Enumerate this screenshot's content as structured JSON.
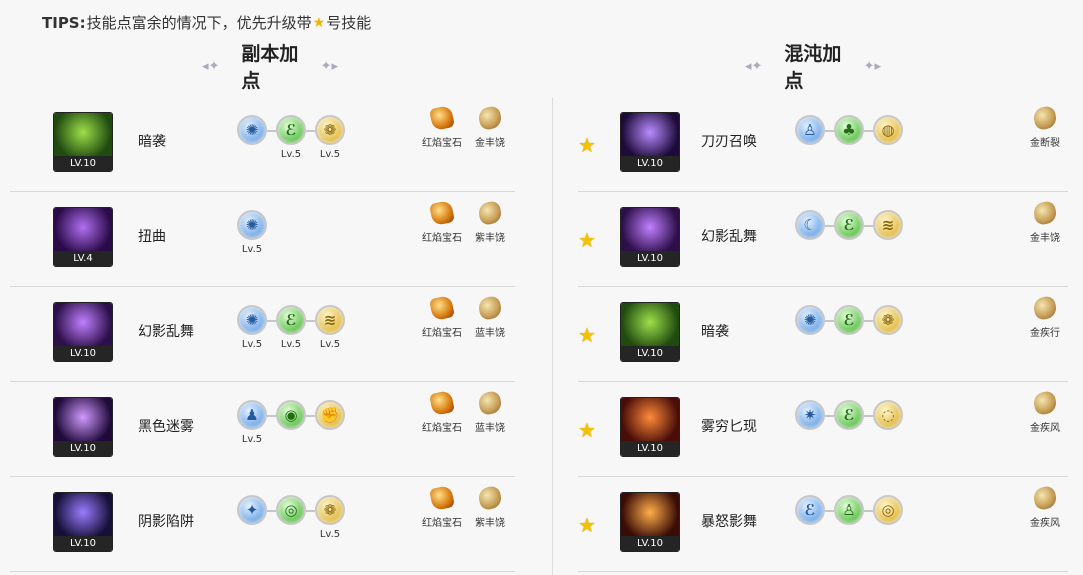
{
  "tips": {
    "prefix": "TIPS:",
    "text_before": "技能点富余的情况下，优先升级带",
    "star": "★",
    "text_after": "号技能"
  },
  "sections": {
    "left_title": "副本加点",
    "right_title": "混沌加点"
  },
  "left_rows": [
    {
      "name": "暗袭",
      "level": "LV.10",
      "runes": [
        {
          "color": "blue",
          "glyph": "✺",
          "lv": ""
        },
        {
          "color": "green",
          "glyph": "ℰ",
          "lv": "Lv.5"
        },
        {
          "color": "gold",
          "glyph": "❁",
          "lv": "Lv.5"
        }
      ],
      "gems": [
        {
          "type": "red",
          "label": "红焰宝石"
        },
        {
          "type": "gold",
          "label": "金丰饶"
        }
      ]
    },
    {
      "name": "扭曲",
      "level": "LV.4",
      "runes": [
        {
          "color": "blue",
          "glyph": "✺",
          "lv": "Lv.5"
        }
      ],
      "gems": [
        {
          "type": "red",
          "label": "红焰宝石"
        },
        {
          "type": "gold",
          "label": "紫丰饶"
        }
      ]
    },
    {
      "name": "幻影乱舞",
      "level": "LV.10",
      "runes": [
        {
          "color": "blue",
          "glyph": "✺",
          "lv": "Lv.5"
        },
        {
          "color": "green",
          "glyph": "ℰ",
          "lv": "Lv.5"
        },
        {
          "color": "gold",
          "glyph": "≋",
          "lv": "Lv.5"
        }
      ],
      "gems": [
        {
          "type": "red",
          "label": "红焰宝石"
        },
        {
          "type": "gold",
          "label": "蓝丰饶"
        }
      ]
    },
    {
      "name": "黑色迷雾",
      "level": "LV.10",
      "runes": [
        {
          "color": "blue",
          "glyph": "♟",
          "lv": "Lv.5"
        },
        {
          "color": "green",
          "glyph": "◉",
          "lv": ""
        },
        {
          "color": "gold",
          "glyph": "✊",
          "lv": ""
        }
      ],
      "gems": [
        {
          "type": "red",
          "label": "红焰宝石"
        },
        {
          "type": "gold",
          "label": "蓝丰饶"
        }
      ]
    },
    {
      "name": "阴影陷阱",
      "level": "LV.10",
      "runes": [
        {
          "color": "blue",
          "glyph": "✦",
          "lv": ""
        },
        {
          "color": "green",
          "glyph": "◎",
          "lv": ""
        },
        {
          "color": "gold",
          "glyph": "❁",
          "lv": "Lv.5"
        }
      ],
      "gems": [
        {
          "type": "red",
          "label": "红焰宝石"
        },
        {
          "type": "gold",
          "label": "紫丰饶"
        }
      ]
    }
  ],
  "right_rows": [
    {
      "name": "刀刃召唤",
      "level": "LV.10",
      "starred": true,
      "runes": [
        {
          "color": "blue",
          "glyph": "♙",
          "lv": ""
        },
        {
          "color": "green",
          "glyph": "♣",
          "lv": ""
        },
        {
          "color": "gold",
          "glyph": "◍",
          "lv": ""
        }
      ],
      "gem": {
        "type": "gold",
        "label": "金断裂"
      }
    },
    {
      "name": "幻影乱舞",
      "level": "LV.10",
      "starred": true,
      "runes": [
        {
          "color": "blue",
          "glyph": "☾",
          "lv": ""
        },
        {
          "color": "green",
          "glyph": "ℰ",
          "lv": ""
        },
        {
          "color": "gold",
          "glyph": "≋",
          "lv": ""
        }
      ],
      "gem": {
        "type": "gold",
        "label": "金丰饶"
      }
    },
    {
      "name": "暗袭",
      "level": "LV.10",
      "starred": true,
      "runes": [
        {
          "color": "blue",
          "glyph": "✺",
          "lv": ""
        },
        {
          "color": "green",
          "glyph": "ℰ",
          "lv": ""
        },
        {
          "color": "gold",
          "glyph": "❁",
          "lv": ""
        }
      ],
      "gem": {
        "type": "gold",
        "label": "金疾行"
      }
    },
    {
      "name": "雾穷匕现",
      "level": "LV.10",
      "starred": true,
      "runes": [
        {
          "color": "blue",
          "glyph": "✷",
          "lv": ""
        },
        {
          "color": "green",
          "glyph": "ℰ",
          "lv": ""
        },
        {
          "color": "gold",
          "glyph": "◌",
          "lv": ""
        }
      ],
      "gem": {
        "type": "gold",
        "label": "金疾风"
      }
    },
    {
      "name": "暴怒影舞",
      "level": "LV.10",
      "starred": true,
      "runes": [
        {
          "color": "blue",
          "glyph": "ℰ",
          "lv": ""
        },
        {
          "color": "green",
          "glyph": "♙",
          "lv": ""
        },
        {
          "color": "gold",
          "glyph": "◎",
          "lv": ""
        }
      ],
      "gem": {
        "type": "gold",
        "label": "金疾风"
      }
    }
  ],
  "icon_palettes": {
    "暗袭": [
      "#9ee04a",
      "#1f4a10"
    ],
    "扭曲": [
      "#b070f0",
      "#2a0a48"
    ],
    "幻影乱舞": [
      "#c080ff",
      "#2d0f4a"
    ],
    "黑色迷雾": [
      "#d09aff",
      "#200a3a"
    ],
    "阴影陷阱": [
      "#9a7cff",
      "#161038"
    ],
    "刀刃召唤": [
      "#b98cff",
      "#1e0b3a"
    ],
    "雾穷匕现": [
      "#ff8a3a",
      "#4a0e08"
    ],
    "暴怒影舞": [
      "#ffae4a",
      "#3a0c06"
    ]
  }
}
